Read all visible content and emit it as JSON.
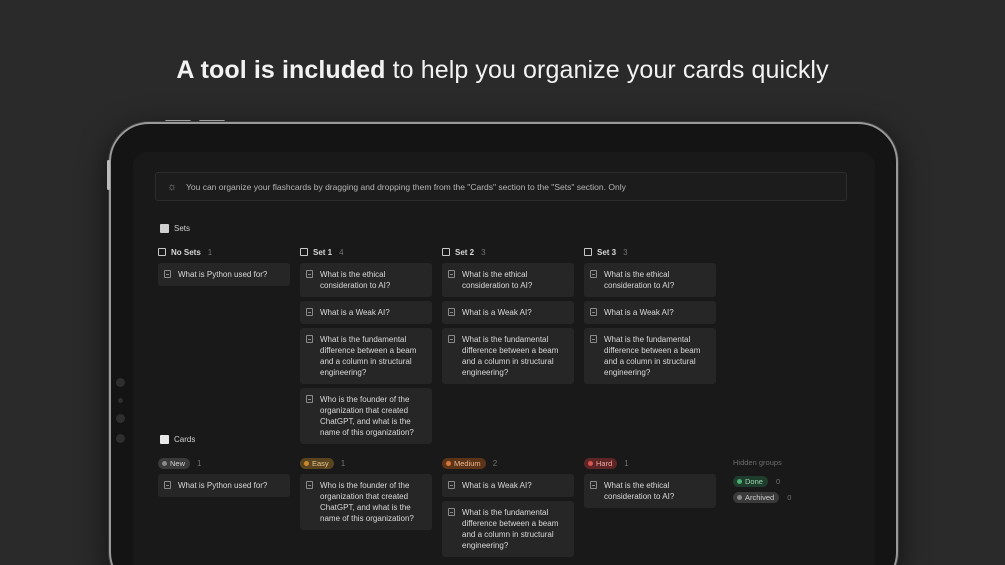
{
  "headline": {
    "bold": "A tool is included",
    "rest": " to help you organize your cards quickly"
  },
  "callout": {
    "text": "You can organize your flashcards by dragging and dropping them from the \"Cards\" section to the \"Sets\" section. Only"
  },
  "sets": {
    "title": "Sets",
    "columns": [
      {
        "label": "No Sets",
        "count": "1",
        "cards": [
          "What is Python used for?"
        ]
      },
      {
        "label": "Set 1",
        "count": "4",
        "cards": [
          "What is the ethical consideration to AI?",
          "What is a Weak AI?",
          "What is the fundamental difference between a beam and a column in structural engineering?",
          "Who is the founder of the organization that created ChatGPT, and what is the name of this organization?"
        ]
      },
      {
        "label": "Set 2",
        "count": "3",
        "cards": [
          "What is the ethical consideration to AI?",
          "What is a Weak AI?",
          "What is the fundamental difference between a beam and a column in structural engineering?"
        ]
      },
      {
        "label": "Set 3",
        "count": "3",
        "cards": [
          "What is the ethical consideration to AI?",
          "What is a Weak AI?",
          "What is the fundamental difference between a beam and a column in structural engineering?"
        ]
      }
    ]
  },
  "cards": {
    "title": "Cards",
    "columns": [
      {
        "label": "New",
        "count": "1",
        "bg": "#3a3a3a",
        "dot": "#8a8a8a",
        "fg": "#d0d0d0",
        "cards": [
          "What is Python used for?"
        ]
      },
      {
        "label": "Easy",
        "count": "1",
        "bg": "#5a4420",
        "dot": "#c98a2e",
        "fg": "#e8c88e",
        "cards": [
          "Who is the founder of the organization that created ChatGPT, and what is the name of this organization?"
        ]
      },
      {
        "label": "Medium",
        "count": "2",
        "bg": "#5c3418",
        "dot": "#d9783a",
        "fg": "#ebb68e",
        "cards": [
          "What is a Weak AI?",
          "What is the fundamental difference between a beam and a column in structural engineering?"
        ]
      },
      {
        "label": "Hard",
        "count": "1",
        "bg": "#5e2525",
        "dot": "#d9534f",
        "fg": "#eaa5a2",
        "cards": [
          "What is the ethical consideration to AI?"
        ]
      }
    ]
  },
  "hidden_groups": {
    "title": "Hidden groups",
    "items": [
      {
        "label": "Done",
        "count": "0",
        "bg": "#1f3d2c",
        "dot": "#4caf72",
        "fg": "#9ed6b3"
      },
      {
        "label": "Archived",
        "count": "0",
        "bg": "#3a3a3a",
        "dot": "#8a8a8a",
        "fg": "#cfcfcf"
      }
    ]
  }
}
